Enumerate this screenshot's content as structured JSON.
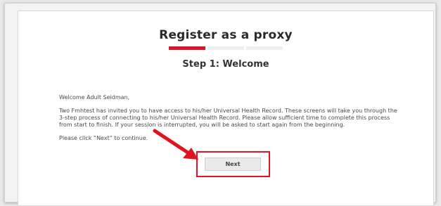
{
  "page": {
    "title": "Register as a proxy",
    "step_title": "Step 1: Welcome",
    "progress": {
      "current_step": 1,
      "total_steps": 3
    },
    "greeting": "Welcome Adult Seidman,",
    "body_text": "Two Fmhtest has invited you to have access to his/her Universal Health Record. These screens will take you through the 3-step process of connecting to his/her Universal Health Record. Please allow sufficient time to complete this process from start to finish. If your session is interrupted, you will be asked to start again from the beginning.",
    "instruction": "Please click “Next” to continue.",
    "next_label": "Next"
  },
  "colors": {
    "accent": "#d7192c",
    "highlight": "#e0141e",
    "card_bg": "#ffffff",
    "page_bg": "#f3f3f3"
  }
}
